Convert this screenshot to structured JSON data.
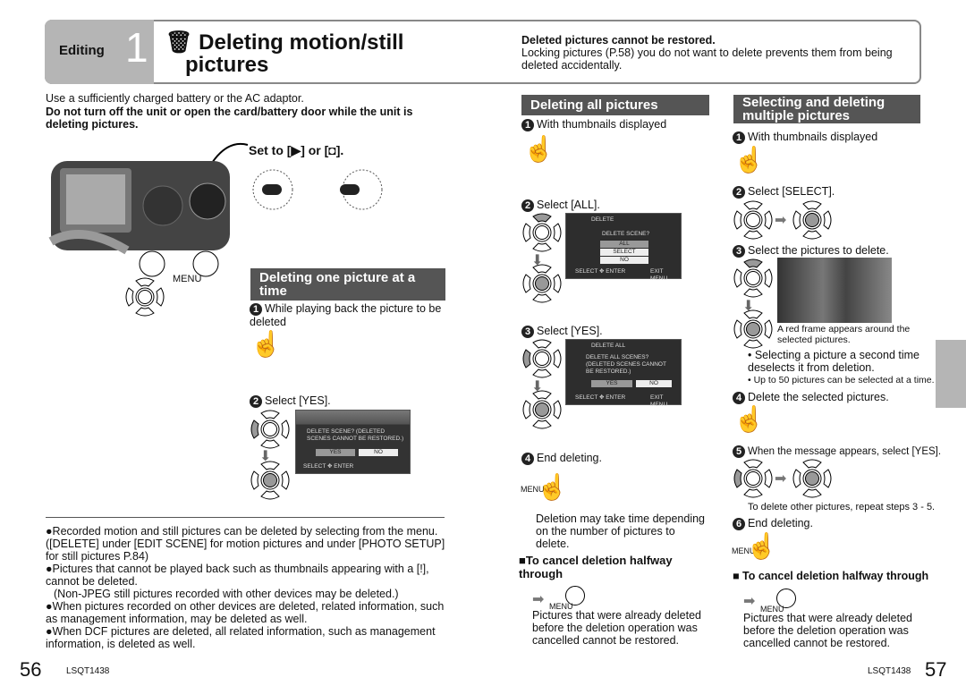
{
  "header": {
    "section": "Editing",
    "number": "1",
    "title_line1": "Deleting motion/still",
    "title_line2": "pictures",
    "note_title": "Deleted pictures cannot be restored.",
    "note_body": "Locking pictures (P.58) you do not want to delete prevents them from being deleted accidentally."
  },
  "left": {
    "intro1": "Use a sufficiently charged battery or the AC adaptor.",
    "intro2": "Do not turn off the unit or open the card/battery door while the unit is deleting pictures.",
    "set_to": "Set to [▶] or [◘].",
    "menu_label": "MENU",
    "one_title": "Deleting one picture at a time",
    "one_step1": "While playing back the picture to be deleted",
    "one_step2": "Select [YES].",
    "screen": {
      "msg": "DELETE SCENE? (DELETED SCENES CANNOT BE RESTORED.)",
      "yes": "YES",
      "no": "NO",
      "footer": "SELECT ✥ ENTER"
    },
    "notes": [
      "●Recorded motion and still pictures can be deleted by selecting from the menu. ([DELETE] under [EDIT SCENE] for motion pictures and under [PHOTO SETUP] for still pictures P.84)",
      "●Pictures that cannot be played back such as thumbnails appearing with a [!], cannot be deleted.",
      "(Non-JPEG still pictures recorded with other devices may be deleted.)",
      "●When pictures recorded on other devices are deleted, related information, such as management information, may be deleted as well.",
      "●When DCF pictures are deleted, all related information, such as management information, is deleted as well."
    ],
    "page_number": "56",
    "code": "LSQT1438"
  },
  "middle": {
    "title": "Deleting all pictures",
    "step1": "With thumbnails displayed",
    "step2": "Select [ALL].",
    "screen2": {
      "title": "DELETE",
      "question": "DELETE SCENE?",
      "opt1": "ALL",
      "opt2": "SELECT",
      "opt3": "NO",
      "footer_left": "SELECT ✥ ENTER",
      "footer_right": "EXIT MENU"
    },
    "step3": "Select [YES].",
    "screen3": {
      "title": "DELETE ALL",
      "question": "DELETE ALL SCENES? (DELETED SCENES CANNOT BE RESTORED.)",
      "yes": "YES",
      "no": "NO",
      "footer_left": "SELECT ✥ ENTER",
      "footer_right": "EXIT MENU"
    },
    "step4": "End deleting.",
    "menu_label": "MENU",
    "note": "Deletion may take time depending on the number of pictures to delete.",
    "cancel_title": "To cancel deletion halfway through",
    "cancel_body": "Pictures that were already deleted before the deletion operation was cancelled cannot be restored."
  },
  "right": {
    "title": "Selecting and deleting multiple pictures",
    "step1": "With thumbnails displayed",
    "step2": "Select [SELECT].",
    "step3": "Select the pictures to delete.",
    "caption": "A red frame appears around the selected pictures.",
    "bullet1": "• Selecting a picture a second time deselects it from deletion.",
    "bullet2": "• Up to 50 pictures can be selected at a time.",
    "step4": "Delete the selected pictures.",
    "step5": "When the message appears, select [YES].",
    "repeat": "To delete other pictures, repeat steps 3 - 5.",
    "step6": "End deleting.",
    "menu_label": "MENU",
    "cancel_title": "To cancel deletion halfway through",
    "cancel_body": "Pictures that were already deleted before the deletion operation was cancelled cannot be restored.",
    "code": "LSQT1438",
    "page_number": "57"
  },
  "step_numbers": [
    "1",
    "2",
    "3",
    "4",
    "5",
    "6"
  ]
}
